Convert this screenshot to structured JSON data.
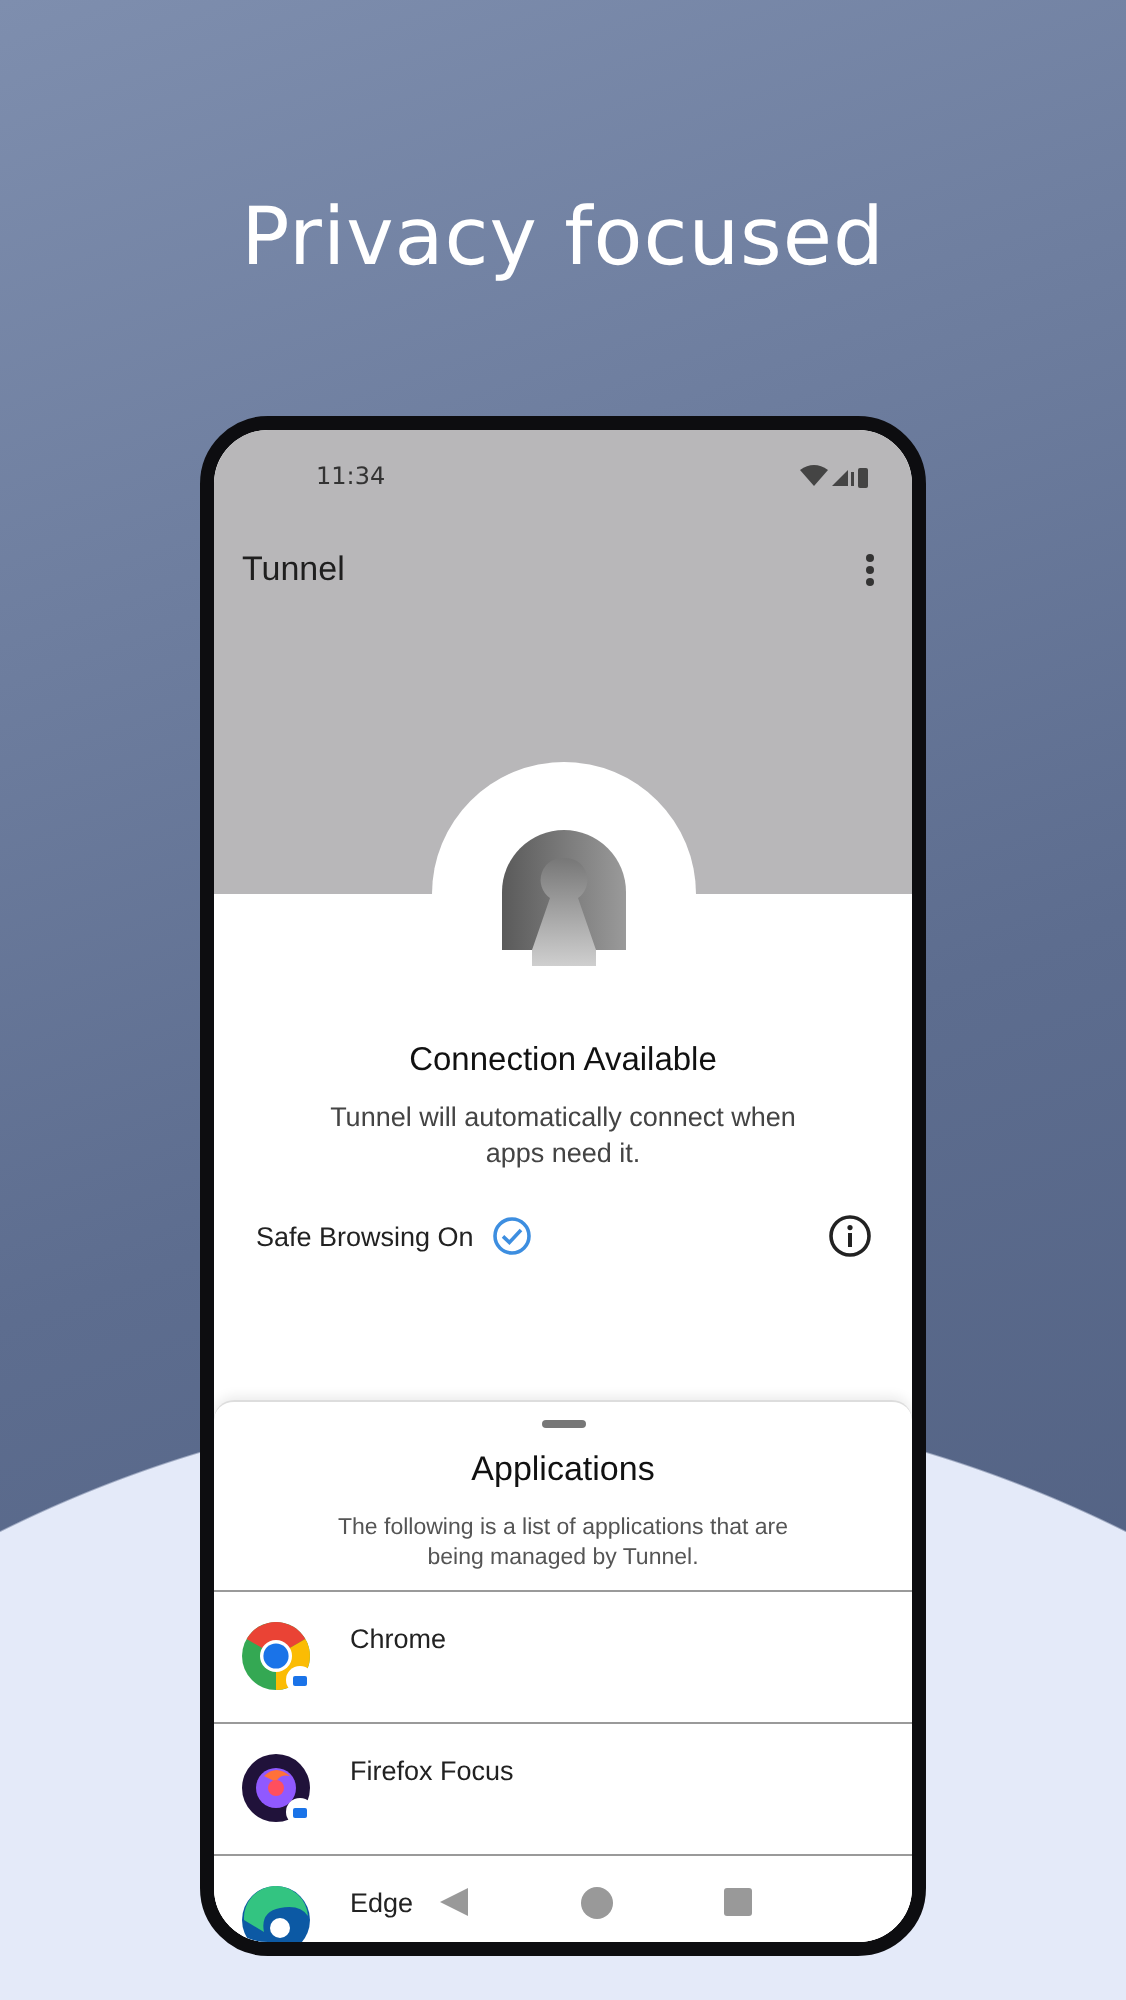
{
  "headline": "Privacy focused",
  "status_bar": {
    "time": "11:34"
  },
  "app_bar": {
    "title": "Tunnel"
  },
  "status": {
    "title": "Connection Available",
    "description": "Tunnel will automatically connect when apps need it."
  },
  "safe_browsing": {
    "label": "Safe Browsing On",
    "checked": true
  },
  "sheet": {
    "title": "Applications",
    "description": "The following is a list of applications that are being managed by Tunnel.",
    "apps": [
      {
        "name": "Chrome",
        "kind": "chrome"
      },
      {
        "name": "Firefox Focus",
        "kind": "firefox"
      },
      {
        "name": "Edge",
        "kind": "edge"
      }
    ]
  }
}
